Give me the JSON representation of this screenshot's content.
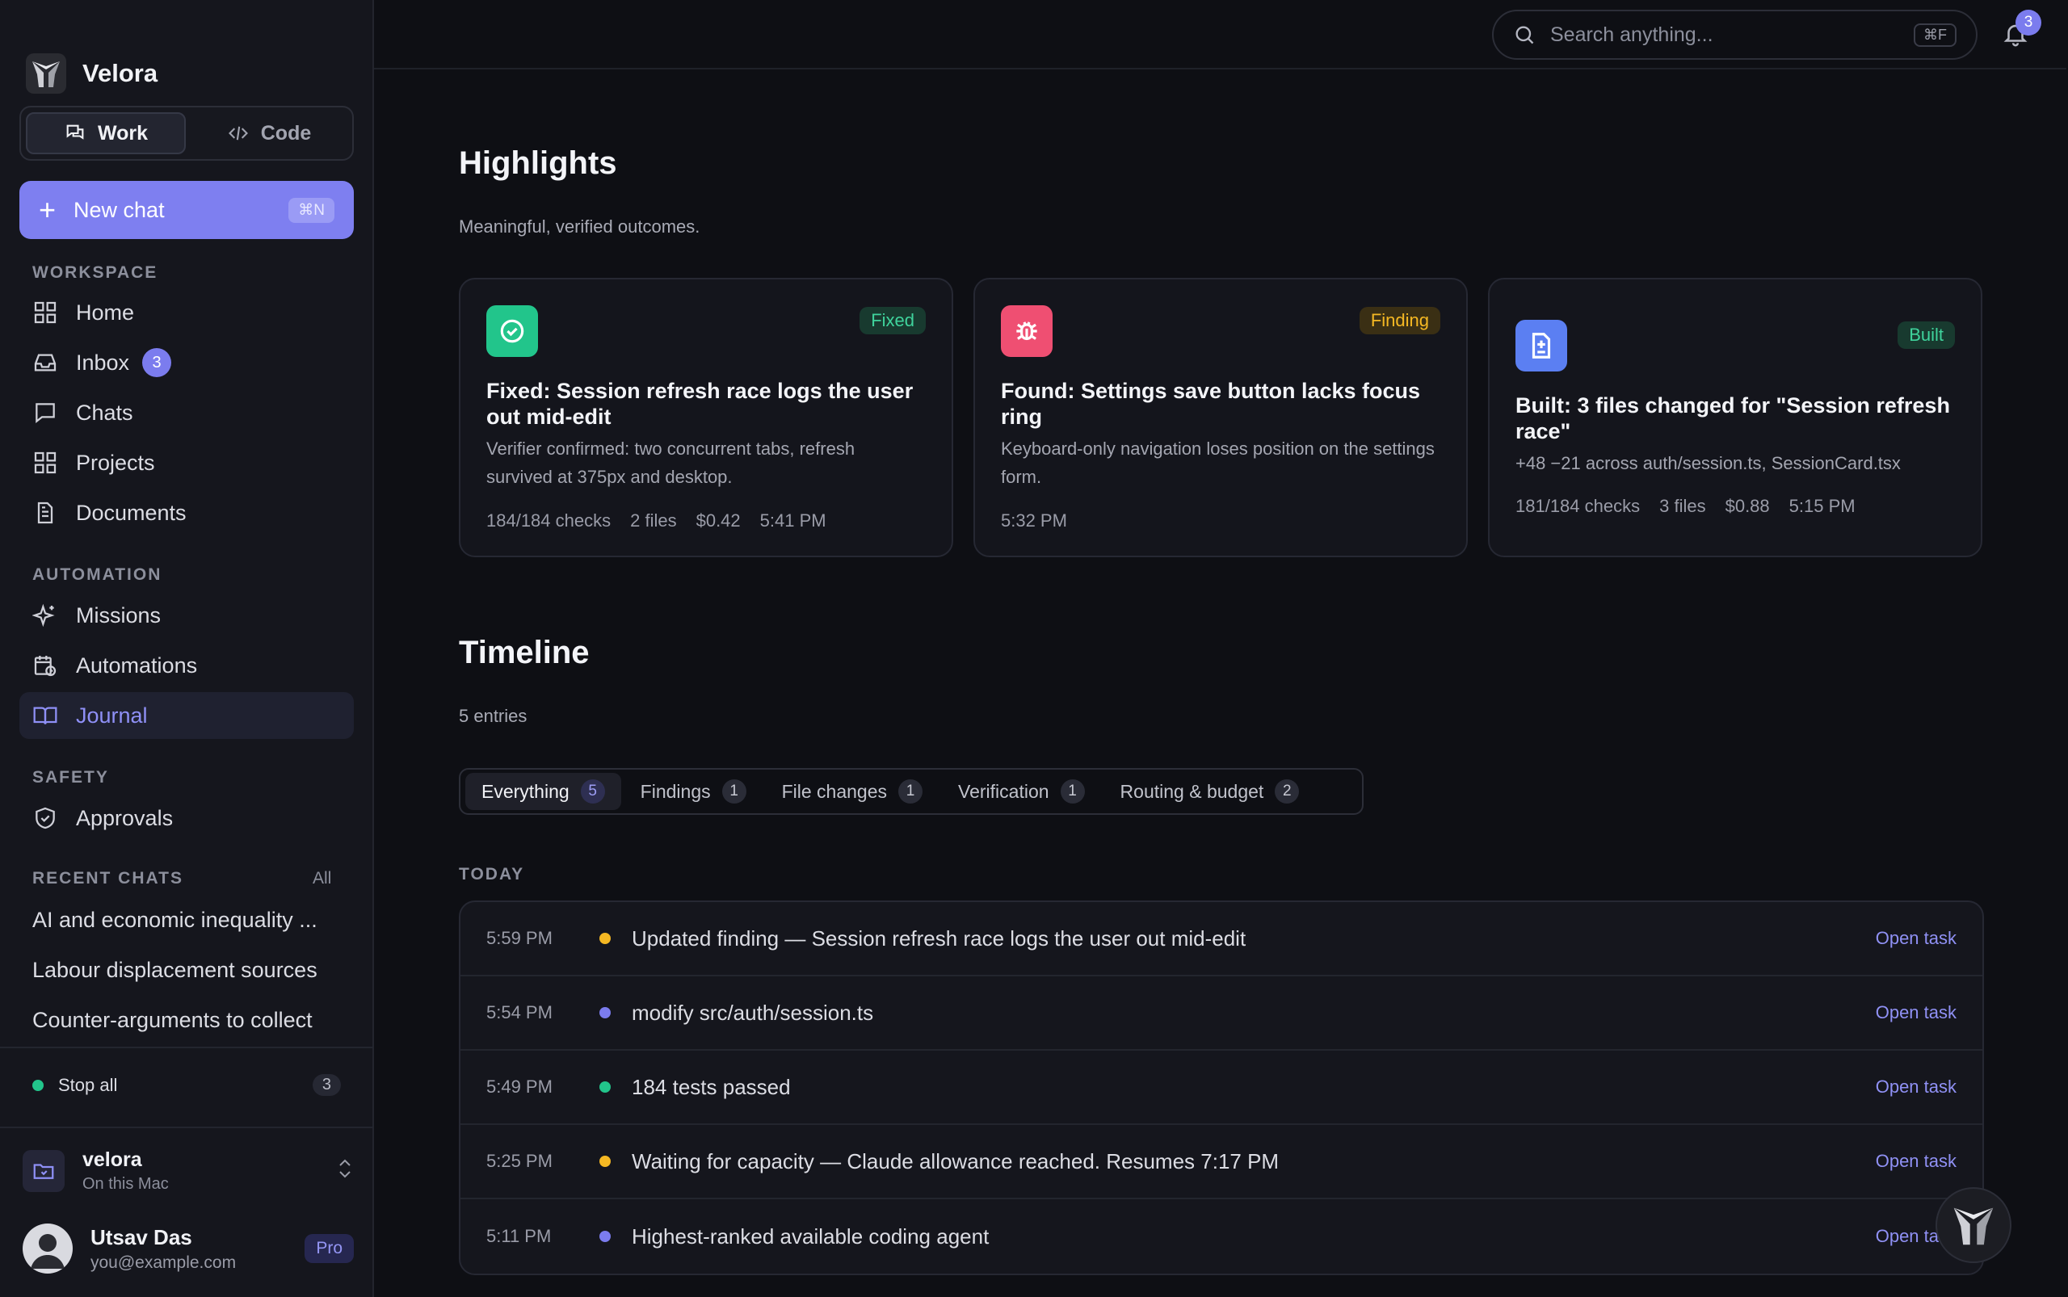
{
  "brand": {
    "name": "Velora"
  },
  "mode": {
    "work": "Work",
    "code": "Code"
  },
  "new_chat": {
    "label": "New chat",
    "shortcut": "⌘N"
  },
  "workspace_section": "WORKSPACE",
  "nav": {
    "home": "Home",
    "inbox": "Inbox",
    "inbox_count": "3",
    "chats": "Chats",
    "projects": "Projects",
    "documents": "Documents"
  },
  "automation_section": "AUTOMATION",
  "automation": {
    "missions": "Missions",
    "automations": "Automations",
    "journal": "Journal"
  },
  "safety_section": "SAFETY",
  "safety": {
    "approvals": "Approvals"
  },
  "recent": {
    "label": "RECENT CHATS",
    "all": "All",
    "items": [
      "AI and economic inequality ...",
      "Labour displacement sources",
      "Counter-arguments to collect"
    ]
  },
  "stop_all": {
    "label": "Stop all",
    "count": "3"
  },
  "workspace": {
    "name": "velora",
    "location": "On this Mac"
  },
  "user": {
    "name": "Utsav Das",
    "email": "you@example.com",
    "plan": "Pro"
  },
  "search": {
    "placeholder": "Search anything...",
    "shortcut": "⌘F"
  },
  "notifications": {
    "count": "3"
  },
  "highlights": {
    "title": "Highlights",
    "subtitle": "Meaningful, verified outcomes.",
    "cards": [
      {
        "tag": "Fixed",
        "title": "Fixed: Session refresh race logs the user out mid-edit",
        "desc": "Verifier confirmed: two concurrent tabs, refresh survived at 375px and desktop.",
        "meta": [
          "184/184 checks",
          "2 files",
          "$0.42",
          "5:41 PM"
        ],
        "icon": "check-circle-icon",
        "color": "#22c58b"
      },
      {
        "tag": "Finding",
        "title": "Found: Settings save button lacks focus ring",
        "desc": "Keyboard-only navigation loses position on the settings form.",
        "meta": [
          "5:32 PM"
        ],
        "icon": "bug-icon",
        "color": "#ef4f72"
      },
      {
        "tag": "Built",
        "title": "Built: 3 files changed for \"Session refresh race\"",
        "desc": "+48 −21 across auth/session.ts, SessionCard.tsx",
        "meta": [
          "181/184 checks",
          "3 files",
          "$0.88",
          "5:15 PM"
        ],
        "icon": "file-diff-icon",
        "color": "#5b7ff2"
      }
    ]
  },
  "timeline": {
    "title": "Timeline",
    "count_label": "5 entries",
    "filters": [
      {
        "label": "Everything",
        "count": "5"
      },
      {
        "label": "Findings",
        "count": "1"
      },
      {
        "label": "File changes",
        "count": "1"
      },
      {
        "label": "Verification",
        "count": "1"
      },
      {
        "label": "Routing & budget",
        "count": "2"
      }
    ],
    "group": "TODAY",
    "entries": [
      {
        "time": "5:59 PM",
        "text": "Updated finding — Session refresh race logs the user out mid-edit",
        "action": "Open task",
        "dot": "#f5b823"
      },
      {
        "time": "5:54 PM",
        "text": "modify src/auth/session.ts",
        "action": "Open task",
        "dot": "#7b7cee"
      },
      {
        "time": "5:49 PM",
        "text": "184 tests passed",
        "action": "Open task",
        "dot": "#22c58b"
      },
      {
        "time": "5:25 PM",
        "text": "Waiting for capacity — Claude allowance reached. Resumes 7:17 PM",
        "action": "Open task",
        "dot": "#f5b823"
      },
      {
        "time": "5:11 PM",
        "text": "Highest-ranked available coding agent",
        "action": "Open task",
        "dot": "#7b7cee"
      }
    ]
  }
}
